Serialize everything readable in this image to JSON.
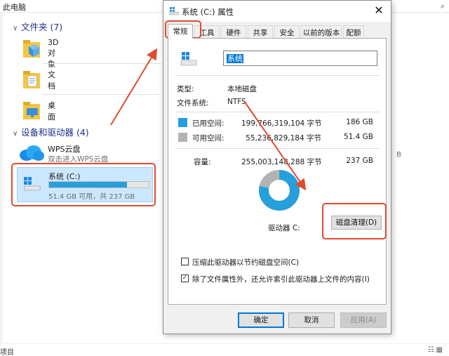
{
  "explorer": {
    "address": "此电脑",
    "search_icon": "search-icon",
    "sections": {
      "folders_title": "文件夹 (7)",
      "devices_title": "设备和驱动器 (4)"
    },
    "folders": [
      {
        "label": "3D 对象"
      },
      {
        "label": "文档"
      },
      {
        "label": "桌面"
      }
    ],
    "wps": {
      "name": "WPS云盘",
      "subtitle": "双击进入WPS云盘"
    },
    "drive": {
      "name": "系统 (C:)",
      "summary": "51.4 GB 可用，共 237 GB",
      "used_fraction": 0.783
    },
    "status_text": "项目",
    "right_peek": "B"
  },
  "dialog": {
    "title": "系统 (C:) 属性",
    "tabs": [
      "常规",
      "工具",
      "硬件",
      "共享",
      "安全",
      "以前的版本",
      "配额"
    ],
    "name_value": "系统",
    "type_label": "类型:",
    "type_value": "本地磁盘",
    "fs_label": "文件系统:",
    "fs_value": "NTFS",
    "used_label": "已用空间:",
    "used_bytes": "199,766,319,104 字节",
    "used_size": "186 GB",
    "free_label": "可用空间:",
    "free_bytes": "55,236,829,184 字节",
    "free_size": "51.4 GB",
    "capacity_label": "容量:",
    "capacity_bytes": "255,003,148,288 字节",
    "capacity_size": "237 GB",
    "drive_caption": "驱动器 C:",
    "cleanup_button": "磁盘清理(D)",
    "compress_option": "压缩此驱动器以节约磁盘空间(C)",
    "index_option": "除了文件属性外，还允许索引此驱动器上文件的内容(I)",
    "compress_checked": false,
    "index_checked": true,
    "ok_button": "确定",
    "cancel_button": "取消",
    "apply_button": "应用(A)",
    "used_fraction": 0.783
  },
  "colors": {
    "used": "#26a0da",
    "free": "#b3b3b3",
    "annotation": "#e04a2f",
    "selection": "#0078d7"
  }
}
